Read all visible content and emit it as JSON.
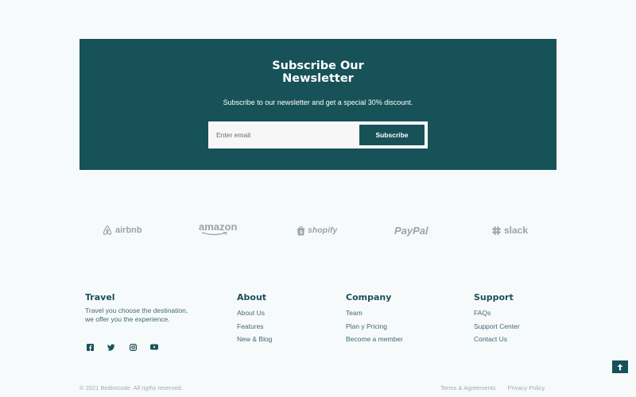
{
  "newsletter": {
    "title": "Subscribe Our\nNewsletter",
    "subtitle": "Subscribe to our newsletter and get a special 30% discount.",
    "email_placeholder": "Enter email",
    "button_label": "Subscribe",
    "background_color": "#175259"
  },
  "partners": [
    {
      "name": "airbnb",
      "icon": "airbnb-logo"
    },
    {
      "name": "amazon",
      "icon": "amazon-logo"
    },
    {
      "name": "shopify",
      "icon": "shopify-logo"
    },
    {
      "name": "PayPal",
      "icon": "paypal-logo"
    },
    {
      "name": "slack",
      "icon": "slack-logo"
    }
  ],
  "footer": {
    "travel": {
      "title": "Travel",
      "description": "Travel you choose the destination, we offer you the experience."
    },
    "about": {
      "title": "About",
      "links": [
        "About Us",
        "Features",
        "New & Blog"
      ]
    },
    "company": {
      "title": "Company",
      "links": [
        "Team",
        "Plan y Pricing",
        "Become a member"
      ]
    },
    "support": {
      "title": "Support",
      "links": [
        "FAQs",
        "Support Center",
        "Contact Us"
      ]
    },
    "socials": [
      "facebook-icon",
      "twitter-icon",
      "instagram-icon",
      "youtube-icon"
    ]
  },
  "bottom": {
    "copyright": "© 2021 Bedimcode. All rigths reserved.",
    "terms": "Terms & Agreements",
    "privacy": "Privacy Policy"
  },
  "back_to_top_icon": "arrow-up-icon"
}
